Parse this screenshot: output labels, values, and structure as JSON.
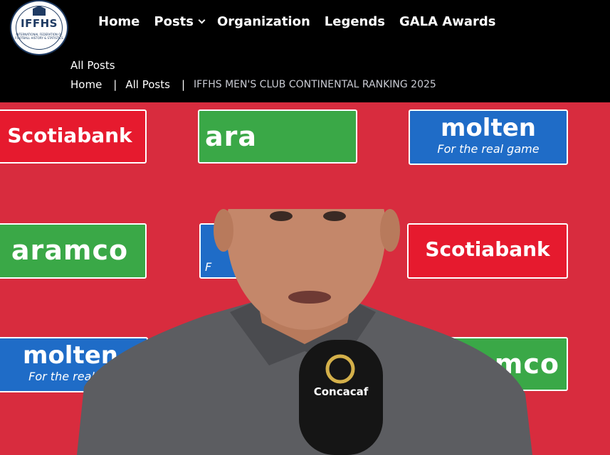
{
  "logo": {
    "text": "IFFHS",
    "subtext": "INTERNATIONAL FEDERATION OF FOOTBALL HISTORY & STATISTICS"
  },
  "nav": {
    "items": [
      {
        "label": "Home"
      },
      {
        "label": "Posts"
      },
      {
        "label": "Organization"
      },
      {
        "label": "Legends"
      },
      {
        "label": "GALA Awards"
      }
    ]
  },
  "page": {
    "heading": "All Posts"
  },
  "breadcrumb": {
    "home": "Home",
    "section": "All Posts",
    "current": "IFFHS MEN'S CLUB CONTINENTAL RANKING 2025"
  },
  "hero": {
    "sponsors": {
      "scotiabank": "Scotiabank",
      "aramco": "aramco",
      "aramco_partial": "ara",
      "aramco_right": "amco",
      "molten": "molten",
      "molten_tagline": "For the real game",
      "molten_tagline_cut": "For the real ga",
      "f_partial": "F"
    },
    "microphone_brand": "Concacaf"
  },
  "colors": {
    "header_bg": "#000000",
    "backdrop_red": "#d82c3e",
    "scotiabank_red": "#e61a2e",
    "aramco_green": "#3aa847",
    "molten_blue": "#1f6cc7"
  }
}
